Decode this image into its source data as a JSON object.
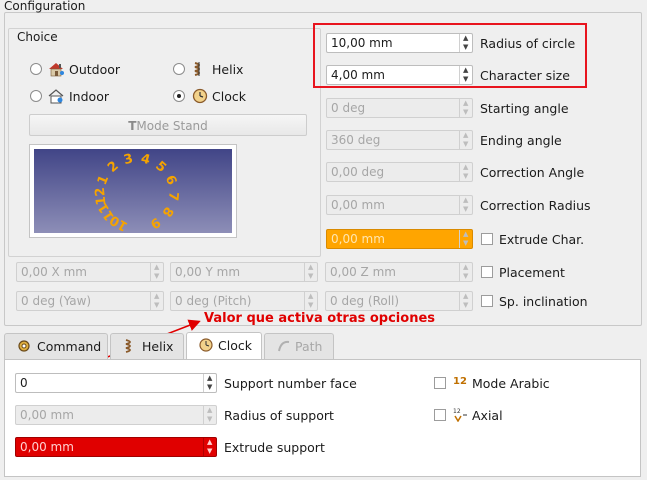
{
  "group": {
    "title": "Configuration"
  },
  "choice": {
    "title": "Choice",
    "options": [
      {
        "label": "Outdoor",
        "checked": false
      },
      {
        "label": "Helix",
        "checked": false
      },
      {
        "label": "Indoor",
        "checked": false
      },
      {
        "label": "Clock",
        "checked": true
      }
    ],
    "mode_button": "Mode Stand"
  },
  "preview": {
    "numbers": [
      "10",
      "11",
      "12",
      "1",
      "2",
      "3",
      "4",
      "5",
      "6",
      "7",
      "8",
      "9"
    ]
  },
  "params": [
    {
      "value": "10,00 mm",
      "label": "Radius of circle",
      "enabled": true
    },
    {
      "value": "4,00 mm",
      "label": "Character size",
      "enabled": true
    },
    {
      "value": "0 deg",
      "label": "Starting angle",
      "enabled": false
    },
    {
      "value": "360 deg",
      "label": "Ending angle",
      "enabled": false
    },
    {
      "value": "0,00 deg",
      "label": "Correction Angle",
      "enabled": false
    },
    {
      "value": "0,00 mm",
      "label": "Correction Radius",
      "enabled": false
    },
    {
      "value": "0,00 mm",
      "label": "Extrude Char.",
      "enabled": false,
      "checkbox": true
    }
  ],
  "placement": {
    "x": "0,00 X mm",
    "y": "0,00 Y mm",
    "z": "0,00 Z mm",
    "yaw": "0 deg (Yaw)",
    "pitch": "0 deg (Pitch)",
    "roll": "0 deg (Roll)",
    "placement_label": "Placement",
    "inclination_label": "Sp. inclination"
  },
  "annotation": {
    "text": "Valor que activa otras opciones"
  },
  "tabs": [
    {
      "label": "Command",
      "active": false,
      "enabled": true
    },
    {
      "label": "Helix",
      "active": false,
      "enabled": true
    },
    {
      "label": "Clock",
      "active": true,
      "enabled": true
    },
    {
      "label": "Path",
      "active": false,
      "enabled": false
    }
  ],
  "clock_tab": {
    "support_face_value": "0",
    "support_face_label": "Support number face",
    "radius_support_value": "0,00 mm",
    "radius_support_label": "Radius of support",
    "extrude_support_value": "0,00 mm",
    "extrude_support_label": "Extrude support",
    "mode_arabic_label": "Mode Arabic",
    "axial_label": "Axial"
  },
  "colors": {
    "highlight_red": "#e8141e",
    "extrude_orange": "#ffa500",
    "extrude_support_red": "#e00000",
    "preview_number": "#f5a300"
  }
}
